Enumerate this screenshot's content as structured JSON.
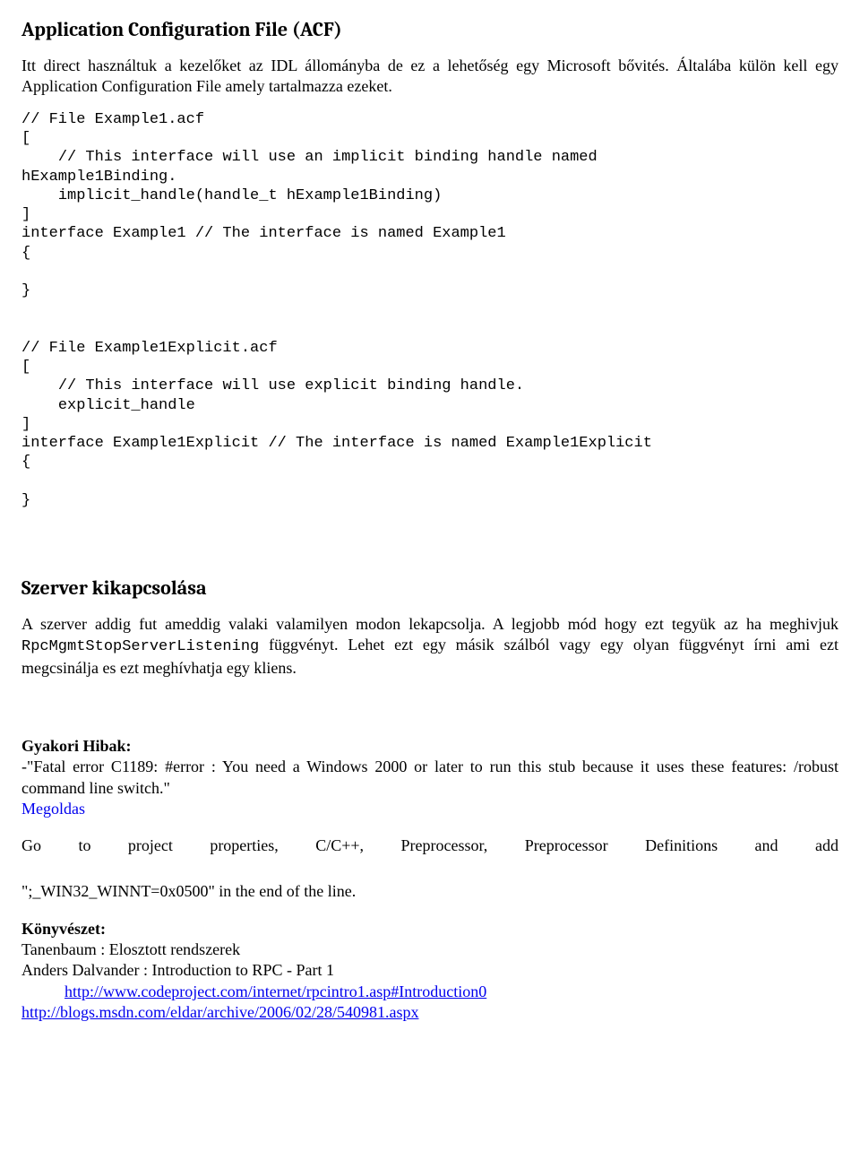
{
  "section1": {
    "title": "Application Configuration File (ACF)",
    "intro": "Itt direct használtuk a kezelőket az IDL állományba de ez a lehetőség egy Microsoft bővités. Általába külön kell egy Application Configuration File amely tartalmazza ezeket."
  },
  "code1": "// File Example1.acf\n[\n    // This interface will use an implicit binding handle named\nhExample1Binding.\n    implicit_handle(handle_t hExample1Binding)\n]\ninterface Example1 // The interface is named Example1\n{\n\n}\n\n\n// File Example1Explicit.acf\n[\n    // This interface will use explicit binding handle.\n    explicit_handle\n]\ninterface Example1Explicit // The interface is named Example1Explicit\n{\n\n}",
  "section2": {
    "title": "Szerver kikapcsolása",
    "p1_a": "A szerver addig fut ameddig valaki valamilyen modon lekapcsolja. A legjobb mód hogy ezt tegyük az ha meghivjuk ",
    "p1_mono": "RpcMgmtStopServerListening",
    "p1_b": " függvényt. Lehet ezt egy másik szálból vagy egy olyan függvényt írni ami ezt megcsinálja es ezt meghívhatja egy kliens."
  },
  "errors": {
    "title": "Gyakori Hibak:",
    "dash": "-",
    "quote": "\"Fatal error C1189: #error : You need a Windows 2000 or later to run this stub because it uses these features: /robust command line switch.\"",
    "megoldas": "Megoldas"
  },
  "solution": {
    "line_pre": "Go to project properties, C/C++, Preprocessor, Preprocessor Definitions and add",
    "line2": "\";_WIN32_WINNT=0x0500\" in the end of the line."
  },
  "refs": {
    "title": "Könyvészet:",
    "r1": "Tanenbaum :  Elosztott rendszerek",
    "r2": "Anders Dalvander : Introduction to RPC - Part 1",
    "link1": "http://www.codeproject.com/internet/rpcintro1.asp#Introduction0",
    "link2": "http://blogs.msdn.com/eldar/archive/2006/02/28/540981.aspx"
  }
}
